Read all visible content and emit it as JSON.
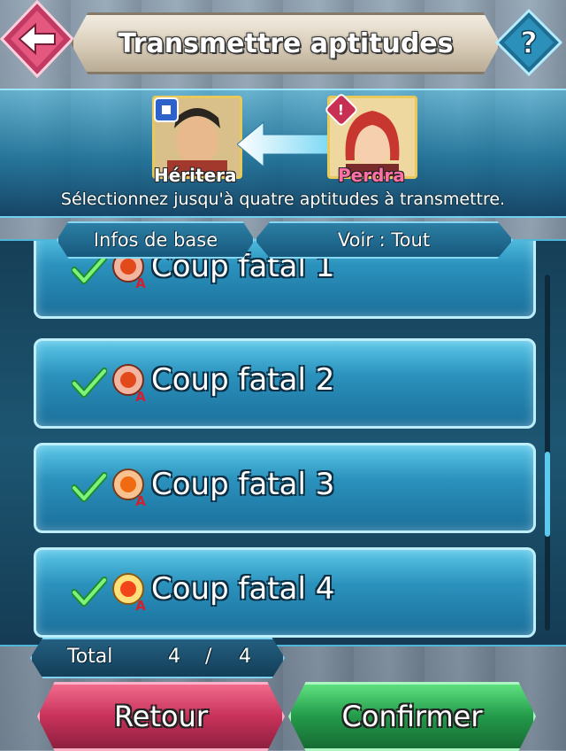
{
  "header": {
    "title": "Transmettre aptitudes"
  },
  "characters": {
    "heir": {
      "label": "Héritera",
      "badge_icon": "square-badge-icon"
    },
    "loser": {
      "label": "Perdra",
      "badge_icon": "warning-badge-icon"
    }
  },
  "instruction": "Sélectionnez jusqu'à quatre aptitudes à transmettre.",
  "filters": {
    "info_label": "Infos de base",
    "view_label": "Voir : Tout"
  },
  "skills": [
    {
      "name": "Coup fatal 1",
      "checked": true
    },
    {
      "name": "Coup fatal 2",
      "checked": true
    },
    {
      "name": "Coup fatal 3",
      "checked": true
    },
    {
      "name": "Coup fatal 4",
      "checked": true
    }
  ],
  "total": {
    "label": "Total",
    "current": "4",
    "separator": "/",
    "max": "4"
  },
  "buttons": {
    "back": "Retour",
    "confirm": "Confirmer"
  },
  "colors": {
    "accent": "#4fb6d8",
    "back": "#c8325a",
    "confirm": "#239a4a",
    "loser_name": "#ff6fa8"
  }
}
